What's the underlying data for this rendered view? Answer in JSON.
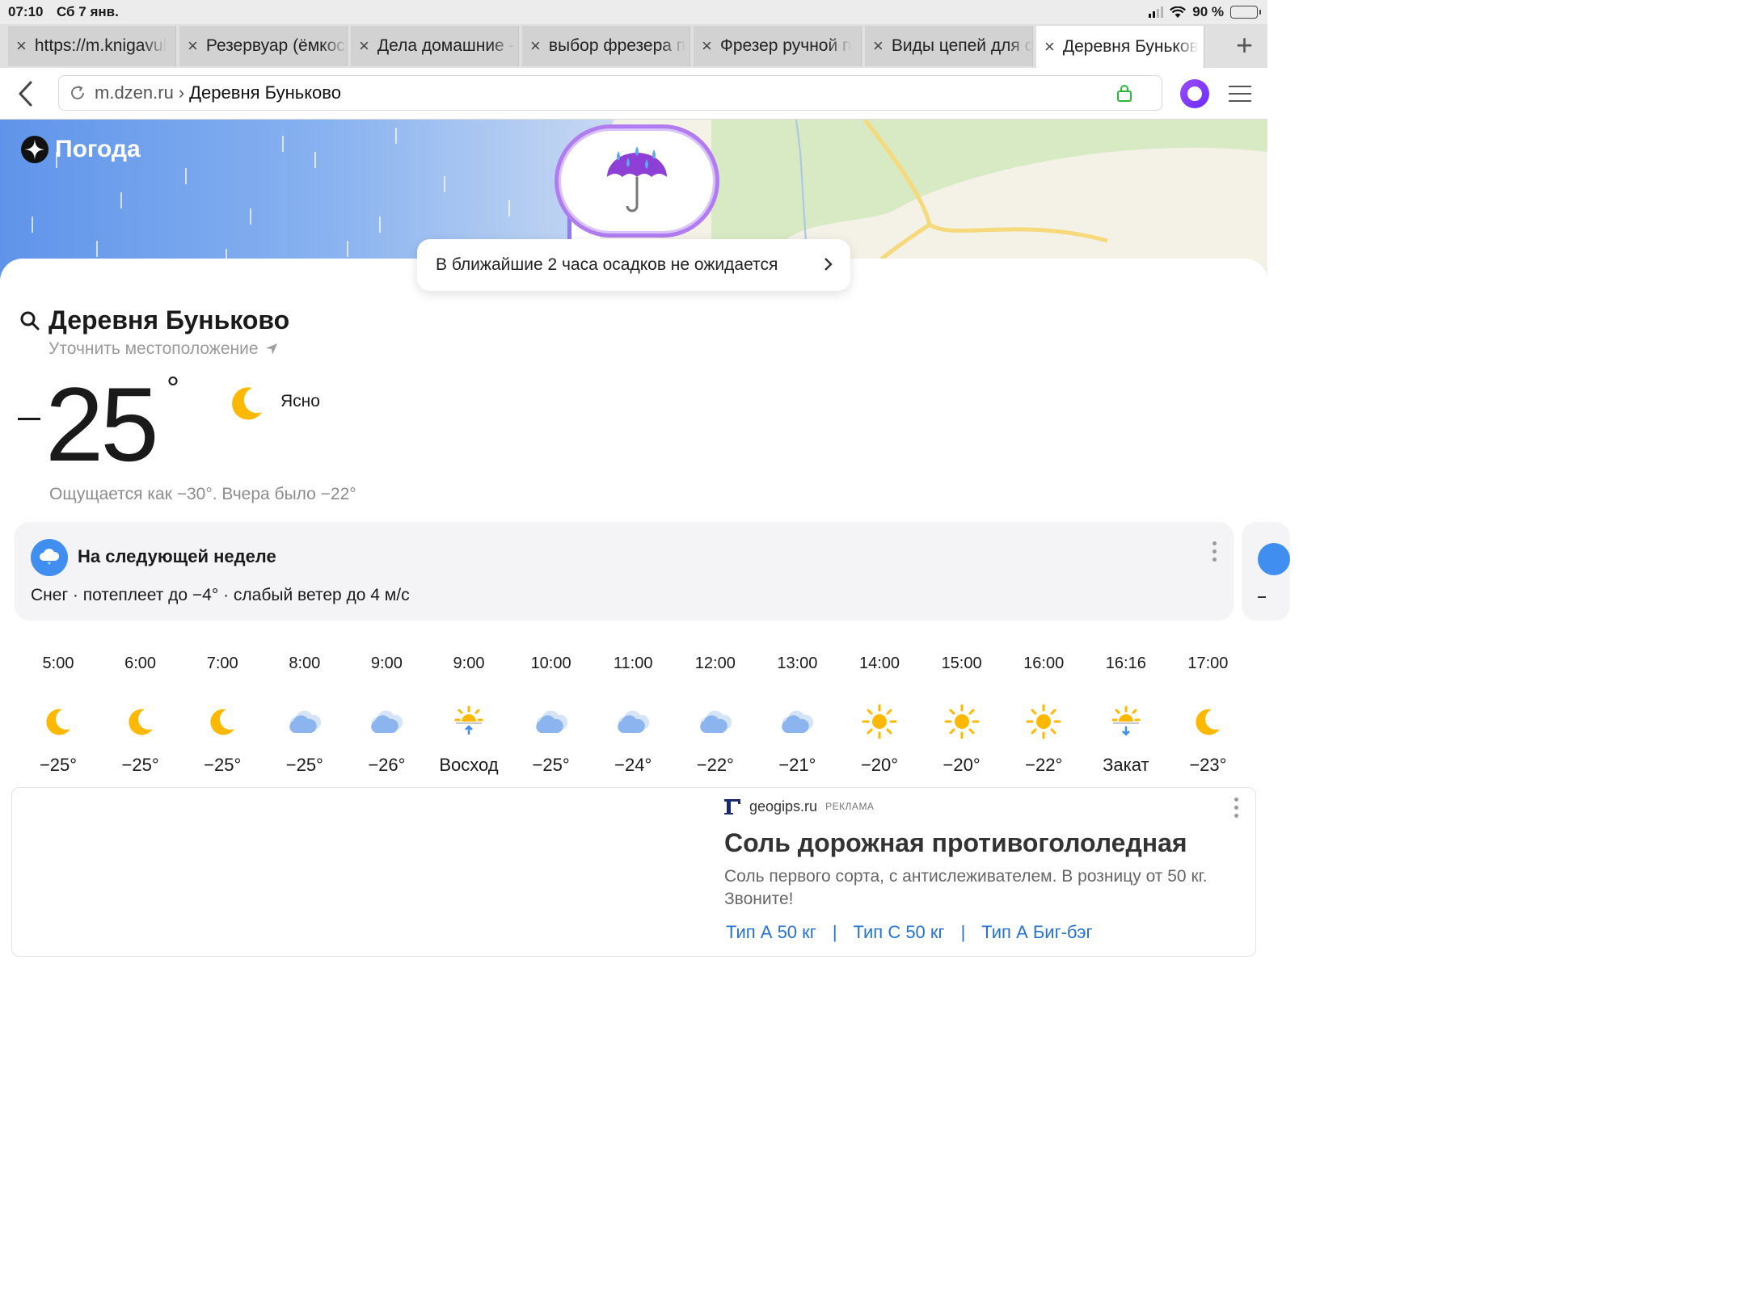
{
  "status_bar": {
    "time": "07:10",
    "date": "Сб 7 янв.",
    "battery": "90 %",
    "battery_level": 0.9
  },
  "tabs": [
    {
      "title": "https://m.knigavul",
      "active": false
    },
    {
      "title": "Резервуар (ёмкость",
      "active": false
    },
    {
      "title": "Дела домашние -",
      "active": false
    },
    {
      "title": "выбор фрезера п",
      "active": false
    },
    {
      "title": "Фрезер ручной п",
      "active": false
    },
    {
      "title": "Виды цепей для с",
      "active": false
    },
    {
      "title": "Деревня Буньков",
      "active": true
    }
  ],
  "address_bar": {
    "domain": "m.dzen.ru",
    "separator": "›",
    "page": "Деревня Буньково"
  },
  "map": {
    "brand": "Погода"
  },
  "nowcast": {
    "text": "В ближайшие 2 часа осадков не ожидается"
  },
  "location": {
    "name": "Деревня Буньково",
    "refine": "Уточнить местоположение"
  },
  "current": {
    "temperature": "25",
    "degree": "°",
    "condition": "Ясно",
    "feels_like": "Ощущается как −30°. Вчера было −22°"
  },
  "week_card": {
    "title": "На следующей неделе",
    "description": "Снег · потеплеет до −4° · слабый ветер до 4 м/с"
  },
  "hourly": [
    {
      "time": "5:00",
      "icon": "moon-icon",
      "value": "−25°"
    },
    {
      "time": "6:00",
      "icon": "moon-icon",
      "value": "−25°"
    },
    {
      "time": "7:00",
      "icon": "moon-icon",
      "value": "−25°"
    },
    {
      "time": "8:00",
      "icon": "cloud-icon",
      "value": "−25°"
    },
    {
      "time": "9:00",
      "icon": "cloud-icon",
      "value": "−26°"
    },
    {
      "time": "9:00",
      "icon": "sunrise-icon",
      "value": "Восход"
    },
    {
      "time": "10:00",
      "icon": "cloud-icon",
      "value": "−25°"
    },
    {
      "time": "11:00",
      "icon": "cloud-icon",
      "value": "−24°"
    },
    {
      "time": "12:00",
      "icon": "cloud-icon",
      "value": "−22°"
    },
    {
      "time": "13:00",
      "icon": "cloud-icon",
      "value": "−21°"
    },
    {
      "time": "14:00",
      "icon": "sun-icon",
      "value": "−20°"
    },
    {
      "time": "15:00",
      "icon": "sun-icon",
      "value": "−20°"
    },
    {
      "time": "16:00",
      "icon": "sun-icon",
      "value": "−22°"
    },
    {
      "time": "16:16",
      "icon": "sunset-icon",
      "value": "Закат"
    },
    {
      "time": "17:00",
      "icon": "moon-icon",
      "value": "−23°"
    }
  ],
  "ad": {
    "domain": "geogips.ru",
    "tag": "РЕКЛАМА",
    "headline": "Соль дорожная противогололедная",
    "text": "Соль первого сорта, с антислеживателем. В розницу от 50 кг. Звоните!",
    "links": [
      "Тип А 50 кг",
      "Тип С 50 кг",
      "Тип А Биг-бэг"
    ],
    "link_separator": "|"
  },
  "colors": {
    "accent_blue": "#3f8ef0",
    "link_blue": "#2472d4",
    "alice_purple": "#7b35ff",
    "sun_yellow": "#ffb800",
    "lock_green": "#2db83d"
  }
}
